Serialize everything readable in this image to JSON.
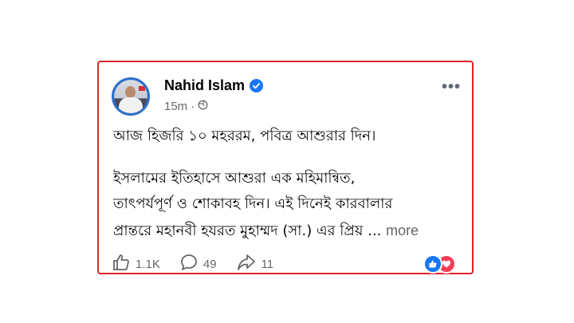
{
  "post": {
    "author": "Nahid Islam",
    "timestamp": "15m",
    "visibility_icon": "globe-icon",
    "lines": [
      "আজ হিজরি ১০ মহররম, পবিত্র আশুরার দিন।",
      "ইসলামের ইতিহাসে আশুরা এক মহিমান্বিত,",
      "তাৎপর্যপূর্ণ ও শোকাবহ দিন। এই দিনেই কারবালার",
      "প্রান্তরে মহানবী হযরত মুহাম্মদ (সা.) এর প্রিয়"
    ],
    "ellipsis": "...",
    "more_label": "more"
  },
  "actions": {
    "likes": "1.1K",
    "comments": "49",
    "shares": "11"
  },
  "colors": {
    "highlight_border": "#e0222a",
    "facebook_blue": "#1877f2",
    "love_red": "#f33e58"
  }
}
